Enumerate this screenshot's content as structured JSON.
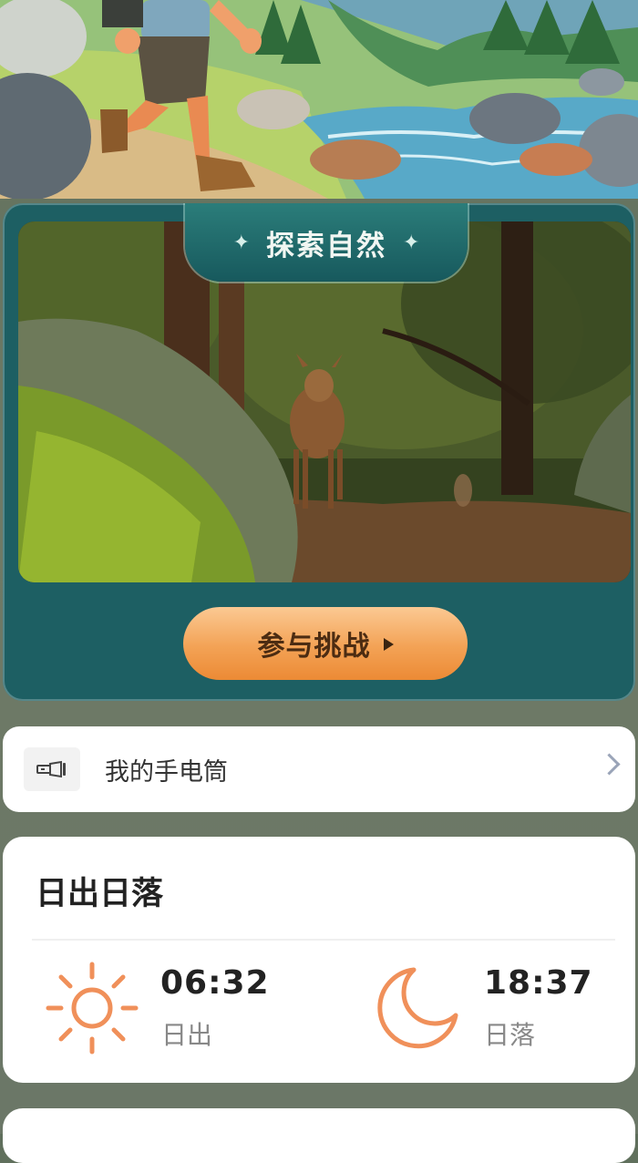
{
  "challenge": {
    "title": "探索自然",
    "button_label": "参与挑战"
  },
  "flashlight": {
    "label": "我的手电筒"
  },
  "sun_card": {
    "title": "日出日落",
    "sunrise": {
      "time": "06:32",
      "label": "日出"
    },
    "sunset": {
      "time": "18:37",
      "label": "日落"
    }
  },
  "icons": {
    "flashlight": "flashlight-icon",
    "sunrise": "sun-icon",
    "sunset": "moon-icon",
    "chevron": "chevron-right-icon"
  },
  "colors": {
    "card_teal": "#1d5f63",
    "button_orange": "#f3a255",
    "icon_orange": "#f0905a"
  }
}
